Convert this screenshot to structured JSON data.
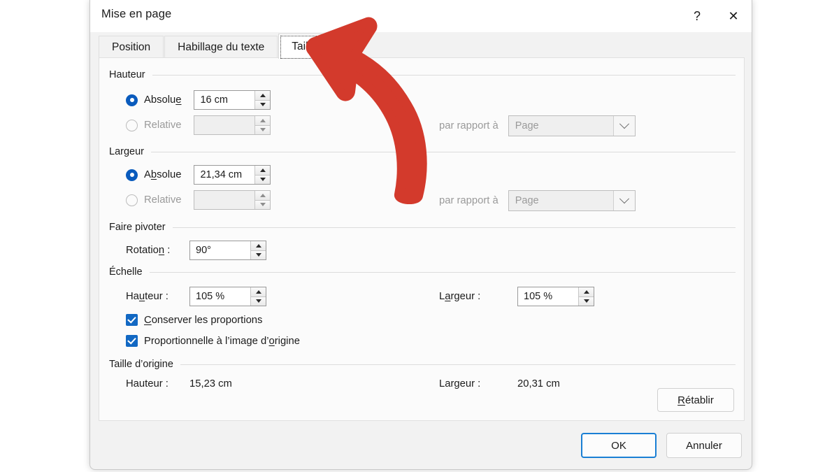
{
  "window": {
    "title": "Mise en page",
    "help_button": "?",
    "close_button": "✕"
  },
  "tabs": [
    {
      "label": "Position",
      "selected": false
    },
    {
      "label": "Habillage du texte",
      "selected": false
    },
    {
      "label": "Taille",
      "selected": true
    }
  ],
  "groups": {
    "hauteur": {
      "title": "Hauteur",
      "absolute": {
        "label_pre": "Absolu",
        "label_accel": "e",
        "label_post": "",
        "value": "16 cm",
        "checked": true
      },
      "relative": {
        "label": "Relative",
        "value": "",
        "checked": false,
        "disabled": true
      },
      "relative_to_label": "par rapport à",
      "relative_to_value": "Page"
    },
    "largeur": {
      "title": "Largeur",
      "absolute": {
        "label_pre": "A",
        "label_accel": "b",
        "label_post": "solue",
        "value": "21,34 cm",
        "checked": true
      },
      "relative": {
        "label": "Relative",
        "value": "",
        "checked": false,
        "disabled": true
      },
      "relative_to_label": "par rapport à",
      "relative_to_value": "Page"
    },
    "faire_pivoter": {
      "title": "Faire pivoter",
      "rotation_label_pre": "Rotatio",
      "rotation_label_accel": "n",
      "rotation_label_post": " :",
      "rotation_value": "90°"
    },
    "echelle": {
      "title": "Échelle",
      "hauteur_label_pre": "Ha",
      "hauteur_label_accel": "u",
      "hauteur_label_post": "teur :",
      "hauteur_value": "105 %",
      "largeur_label_pre": "L",
      "largeur_label_accel": "a",
      "largeur_label_post": "rgeur :",
      "largeur_value": "105 %",
      "checkbox_proportions_pre": "",
      "checkbox_proportions_accel": "C",
      "checkbox_proportions_post": "onserver les proportions",
      "checkbox_proportions_checked": true,
      "checkbox_original_pre": "Proportionnelle à l’image d’",
      "checkbox_original_accel": "o",
      "checkbox_original_post": "rigine",
      "checkbox_original_checked": true
    },
    "taille_origine": {
      "title": "Taille d’origine",
      "hauteur_label": "Hauteur :",
      "hauteur_value": "15,23 cm",
      "largeur_label": "Largeur :",
      "largeur_value": "20,31 cm"
    }
  },
  "buttons": {
    "reset_pre": "",
    "reset_accel": "R",
    "reset_post": "établir",
    "ok": "OK",
    "cancel": "Annuler"
  },
  "annotation": {
    "color": "#d33a2c",
    "target": "Taille"
  }
}
